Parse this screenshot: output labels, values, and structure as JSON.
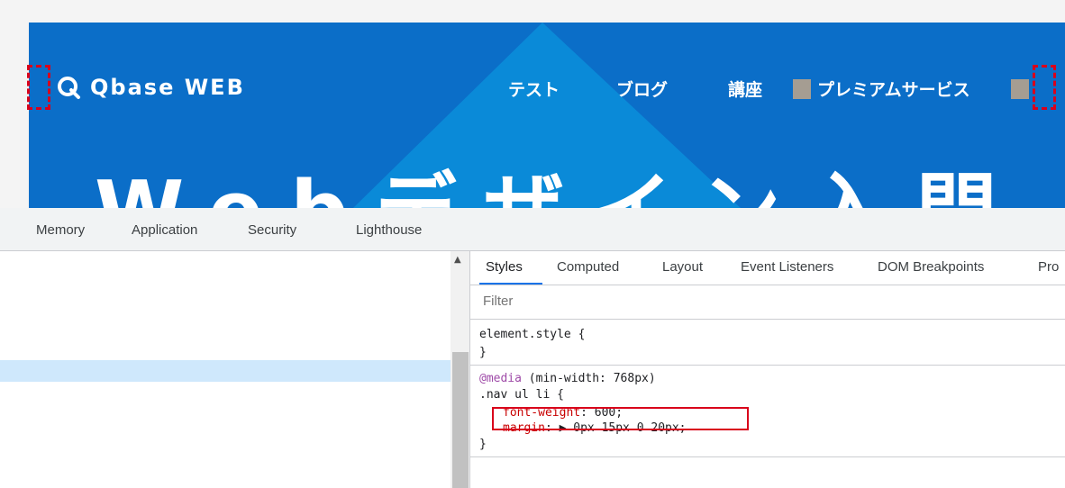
{
  "site": {
    "logo_text": "Qbase WEB",
    "nav": [
      {
        "label": "テスト"
      },
      {
        "label": "ブログ"
      },
      {
        "label": "講座"
      },
      {
        "label": "プレミアムサービス"
      }
    ],
    "hero_text": "Webデザイン入門",
    "colors": {
      "hero_bg": "#0b6ec8",
      "triangle": "#0a8ad8",
      "margin_pad": "#a59d92",
      "annotation": "#d9001b"
    }
  },
  "devtools": {
    "top_tabs": [
      "Memory",
      "Application",
      "Security",
      "Lighthouse"
    ],
    "sub_tabs": [
      "Styles",
      "Computed",
      "Layout",
      "Event Listeners",
      "DOM Breakpoints",
      "Pro"
    ],
    "active_sub_tab": "Styles",
    "filter_placeholder": "Filter",
    "rules": {
      "element_style_open": "element.style {",
      "element_style_close": "}",
      "media_keyword": "@media",
      "media_query": " (min-width: 768px)",
      "selector": ".nav ul li {",
      "decl1_prop": "font-weight",
      "decl1_value": ": 600;",
      "decl2_prop": "margin",
      "decl2_value": ": ▶ 0px 15px 0 20px;",
      "close": "}"
    }
  }
}
